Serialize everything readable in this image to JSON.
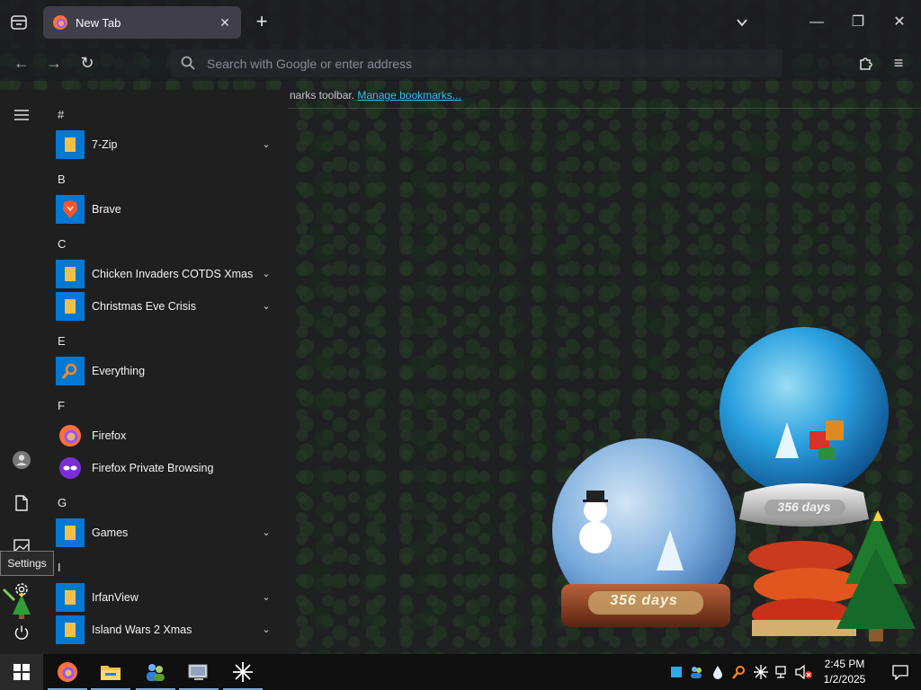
{
  "browser": {
    "tab_title": "New Tab",
    "address_placeholder": "Search with Google or enter address",
    "bookmarks_text": "narks toolbar.",
    "bookmarks_link": "Manage bookmarks..."
  },
  "start_menu": {
    "sections": [
      {
        "letter": "#",
        "apps": [
          {
            "name": "7-Zip",
            "icon": "folder-icon",
            "expandable": true
          }
        ]
      },
      {
        "letter": "B",
        "apps": [
          {
            "name": "Brave",
            "icon": "brave-icon",
            "expandable": false
          }
        ]
      },
      {
        "letter": "C",
        "apps": [
          {
            "name": "Chicken Invaders COTDS Xmas",
            "icon": "folder-icon",
            "expandable": true
          },
          {
            "name": "Christmas Eve Crisis",
            "icon": "folder-icon",
            "expandable": true
          }
        ]
      },
      {
        "letter": "E",
        "apps": [
          {
            "name": "Everything",
            "icon": "everything-icon",
            "expandable": false
          }
        ]
      },
      {
        "letter": "F",
        "apps": [
          {
            "name": "Firefox",
            "icon": "firefox-icon",
            "expandable": false
          },
          {
            "name": "Firefox Private Browsing",
            "icon": "firefox-private-icon",
            "expandable": false
          }
        ]
      },
      {
        "letter": "G",
        "apps": [
          {
            "name": "Games",
            "icon": "folder-icon",
            "expandable": true
          }
        ]
      },
      {
        "letter": "I",
        "apps": [
          {
            "name": "IrfanView",
            "icon": "folder-icon",
            "expandable": true
          },
          {
            "name": "Island Wars 2 Xmas",
            "icon": "folder-icon",
            "expandable": true
          }
        ]
      }
    ],
    "tooltip": "Settings"
  },
  "desktop": {
    "globe_small_label": "356 days",
    "globe_large_label": "356 days"
  },
  "taskbar": {
    "time": "2:45 PM",
    "date": "1/2/2025"
  },
  "colors": {
    "accent": "#0078d4",
    "folder": "#f5c04a",
    "link": "#2ec4e0"
  }
}
